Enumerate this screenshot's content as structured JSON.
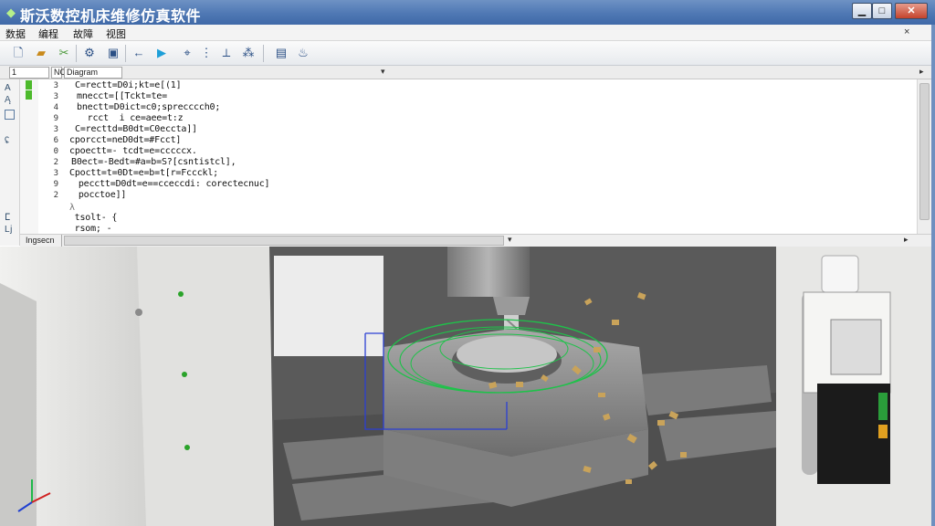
{
  "window": {
    "title": "斯沃数控机床维修仿真软件",
    "minimize_glyph": "▁",
    "maximize_glyph": "□",
    "close_glyph": "✕"
  },
  "menu": {
    "items": [
      "数据",
      "编程",
      "故障",
      "视图"
    ],
    "mdi_close_glyph": "×"
  },
  "toolbar": {
    "icons": [
      "new-file-icon",
      "open-folder-icon",
      "cut-icon",
      "gear-icon",
      "settings-icon",
      "back-arrow-icon",
      "run-icon",
      "tool-setup-icon",
      "probe-icon",
      "measure-icon",
      "save-icon",
      "coolant-icon"
    ]
  },
  "tabs": {
    "field1": "1",
    "field2": "NC",
    "field3": "Diagram"
  },
  "editor": {
    "line_numbers": [
      "3",
      "3",
      "4",
      "9",
      "3",
      "6",
      "0",
      "2",
      "3",
      "9",
      "2",
      "",
      ""
    ],
    "code_lines": [
      "C=rectt=D0i;kt=e[(1]",
      "mnecct=[[Tckt=te=",
      "bnectt=D0ict=c0;sprecccch0;",
      "  rcct  i ce=aee=t:z",
      "C=recttd=B0dt=C0eccta]]",
      "cporcct=neD0dt=#Fcct]",
      "cpoectt=- tcdt=e=cccccx.",
      "B0ect=-Bedt=#a=b=S?[csntistcl],",
      "Cpoctt=t=0Dt=e=b=t[r=Fccckl;",
      " pecctt=D0dt=e==cceccdi: corectecnuc]",
      " pocctoe]]",
      "λ",
      "  tsolt- {",
      "  rsom; -"
    ],
    "mode_tab": "Ingsecn"
  },
  "viewport": {
    "machine_colors": {
      "enclosure": "#e4e4e2",
      "table": "#6f6f6f",
      "workpiece": "#8e8e8e",
      "toolpath": "#1fc24a",
      "bounding": "#2b3fd4",
      "chips": "#c9a35a"
    },
    "panel_status": "green"
  }
}
